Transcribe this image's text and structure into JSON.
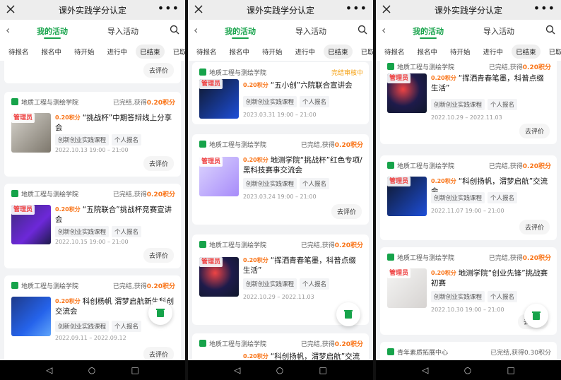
{
  "title": "课外实践学分认定",
  "tabs": {
    "mine": "我的活动",
    "import": "导入活动"
  },
  "subtabs": [
    "待报名",
    "报名中",
    "待开始",
    "进行中",
    "已结束",
    "已取消"
  ],
  "active_subtab": "已结束",
  "common": {
    "org": "地质工程与测绘学院",
    "admin": "管理员",
    "course_tag": "创新创业实践课程",
    "signup_tag": "个人报名",
    "eval": "去评价",
    "points_badge": "0.20积分",
    "done_prefix": "已完结,获得",
    "points": "0.20积分",
    "review_status": "完结审核中",
    "done_label": "已完结,获得"
  },
  "phones": [
    {
      "cards": [
        {
          "title": "“挑战杯”中期答辩线上分享会",
          "date": "2022.10.13 19:00 – 21:00"
        },
        {
          "title": "“五院联合”挑战杯竞赛宣讲会",
          "date": "2022.10.15 19:00 – 21:00"
        },
        {
          "title": "科创杨帆 渭梦启航新生科创交流会",
          "date": "2022.09.11 – 2022.09.12"
        }
      ]
    },
    {
      "cards": [
        {
          "title": "“五小创”六院联合宣讲会",
          "date": "2023.03.31 19:00 – 21:00"
        },
        {
          "title": "地测学院“挑战杯”红色专项/黑科技赛事交流会",
          "date": "2023.03.24 19:00 – 21:00"
        },
        {
          "title": "“挥洒青春笔墨，科普点缀生活”",
          "date": "2022.10.29 – 2022.11.03"
        },
        {
          "title": "“科创扬帆，渭梦启航”交流会",
          "date": ""
        }
      ]
    },
    {
      "cards": [
        {
          "title": "“挥洒青春笔墨，科普点缀生活”",
          "date": "2022.10.29 – 2022.11.03"
        },
        {
          "title": "“科创扬帆，渭梦启航”交流会",
          "date": "2022.11.07 19:00 – 21:00"
        },
        {
          "title": "地测学院“创业先锋”挑战赛初赛",
          "date": "2022.10.30 19:00 – 21:00"
        }
      ],
      "next_org": "青年素质拓展中心",
      "next_status": "已完结,获得0.30积分"
    }
  ],
  "colors": {
    "brand": "#16a34a",
    "points": "#f97316",
    "review": "#f59e0b"
  }
}
